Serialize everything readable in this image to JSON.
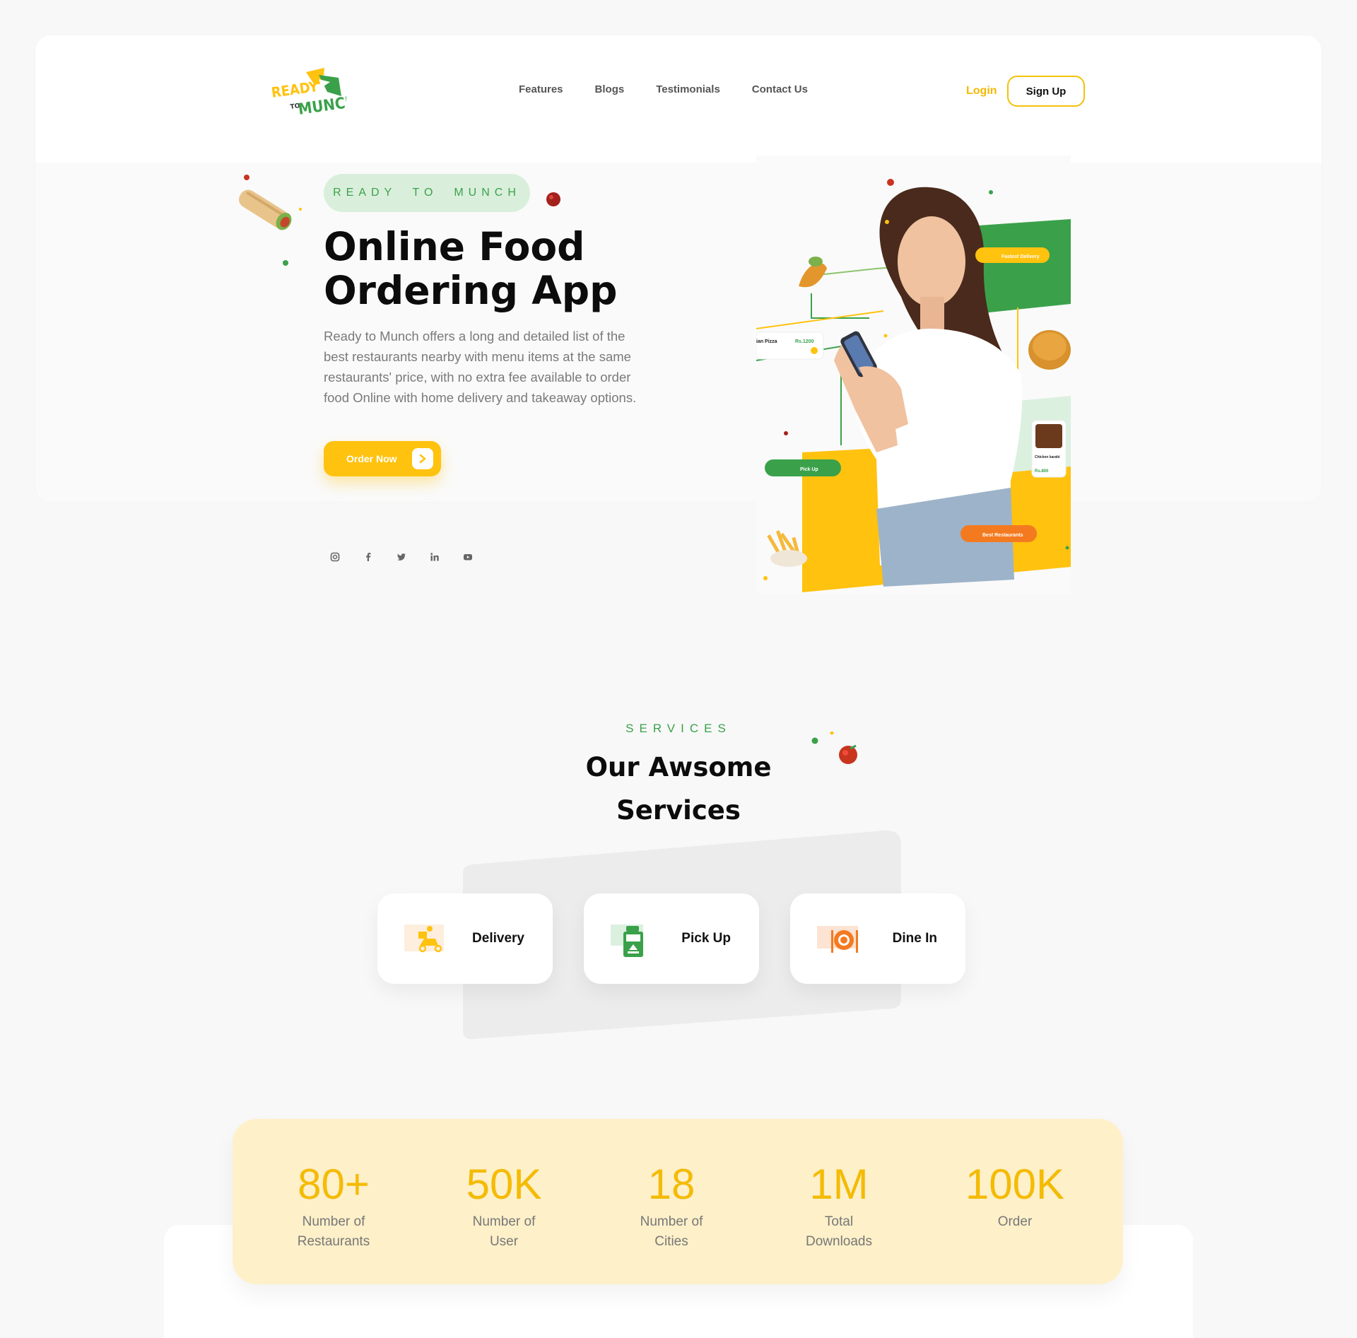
{
  "brand": {
    "logo_line1": "READY",
    "logo_line2": "TO",
    "logo_line3": "MUNCH"
  },
  "nav": {
    "links": [
      "Features",
      "Blogs",
      "Testimonials",
      "Contact Us"
    ],
    "login_label": "Login",
    "signup_label": "Sign Up"
  },
  "hero": {
    "eyebrow": "READY  TO  MUNCH",
    "title_line1": "Online Food",
    "title_line2": "Ordering App",
    "description": "Ready to Munch offers a long and detailed list of the best restaurants nearby with menu items at the same restaurants' price, with no extra fee available to order food Online with home delivery and takeaway options.",
    "cta_label": "Order Now",
    "socials": [
      "instagram-icon",
      "facebook-icon",
      "twitter-icon",
      "linkedin-icon",
      "youtube-icon"
    ],
    "image_tags": {
      "fastest_delivery": "Fastest Delivery",
      "pick_up": "Pick Up",
      "best_restaurants": "Best Restaurants",
      "pizza_name": "ian Pizza",
      "pizza_price": "Rs.1200",
      "dish_name": "Chicken karahi",
      "dish_price": "Rs.800"
    }
  },
  "services": {
    "eyebrow": "SERVICES",
    "title_line1": "Our Awsome",
    "title_line2": "Services",
    "items": [
      {
        "name": "Delivery",
        "icon": "delivery-scooter-icon"
      },
      {
        "name": "Pick Up",
        "icon": "pickup-bag-icon"
      },
      {
        "name": "Dine In",
        "icon": "dine-in-plate-icon"
      }
    ]
  },
  "stats": [
    {
      "value": "80+",
      "label_line1": "Number of",
      "label_line2": "Restaurants"
    },
    {
      "value": "50K",
      "label_line1": "Number of",
      "label_line2": "User"
    },
    {
      "value": "18",
      "label_line1": "Number of",
      "label_line2": "Cities"
    },
    {
      "value": "1M",
      "label_line1": "Total",
      "label_line2": "Downloads"
    },
    {
      "value": "100K",
      "label_line1": "Order",
      "label_line2": ""
    }
  ],
  "colors": {
    "accent_yellow": "#ffc20e",
    "accent_green": "#3aa14a",
    "orange": "#f47a20",
    "pill_green": "#d9efdb",
    "stats_bg": "#fef0c9"
  }
}
